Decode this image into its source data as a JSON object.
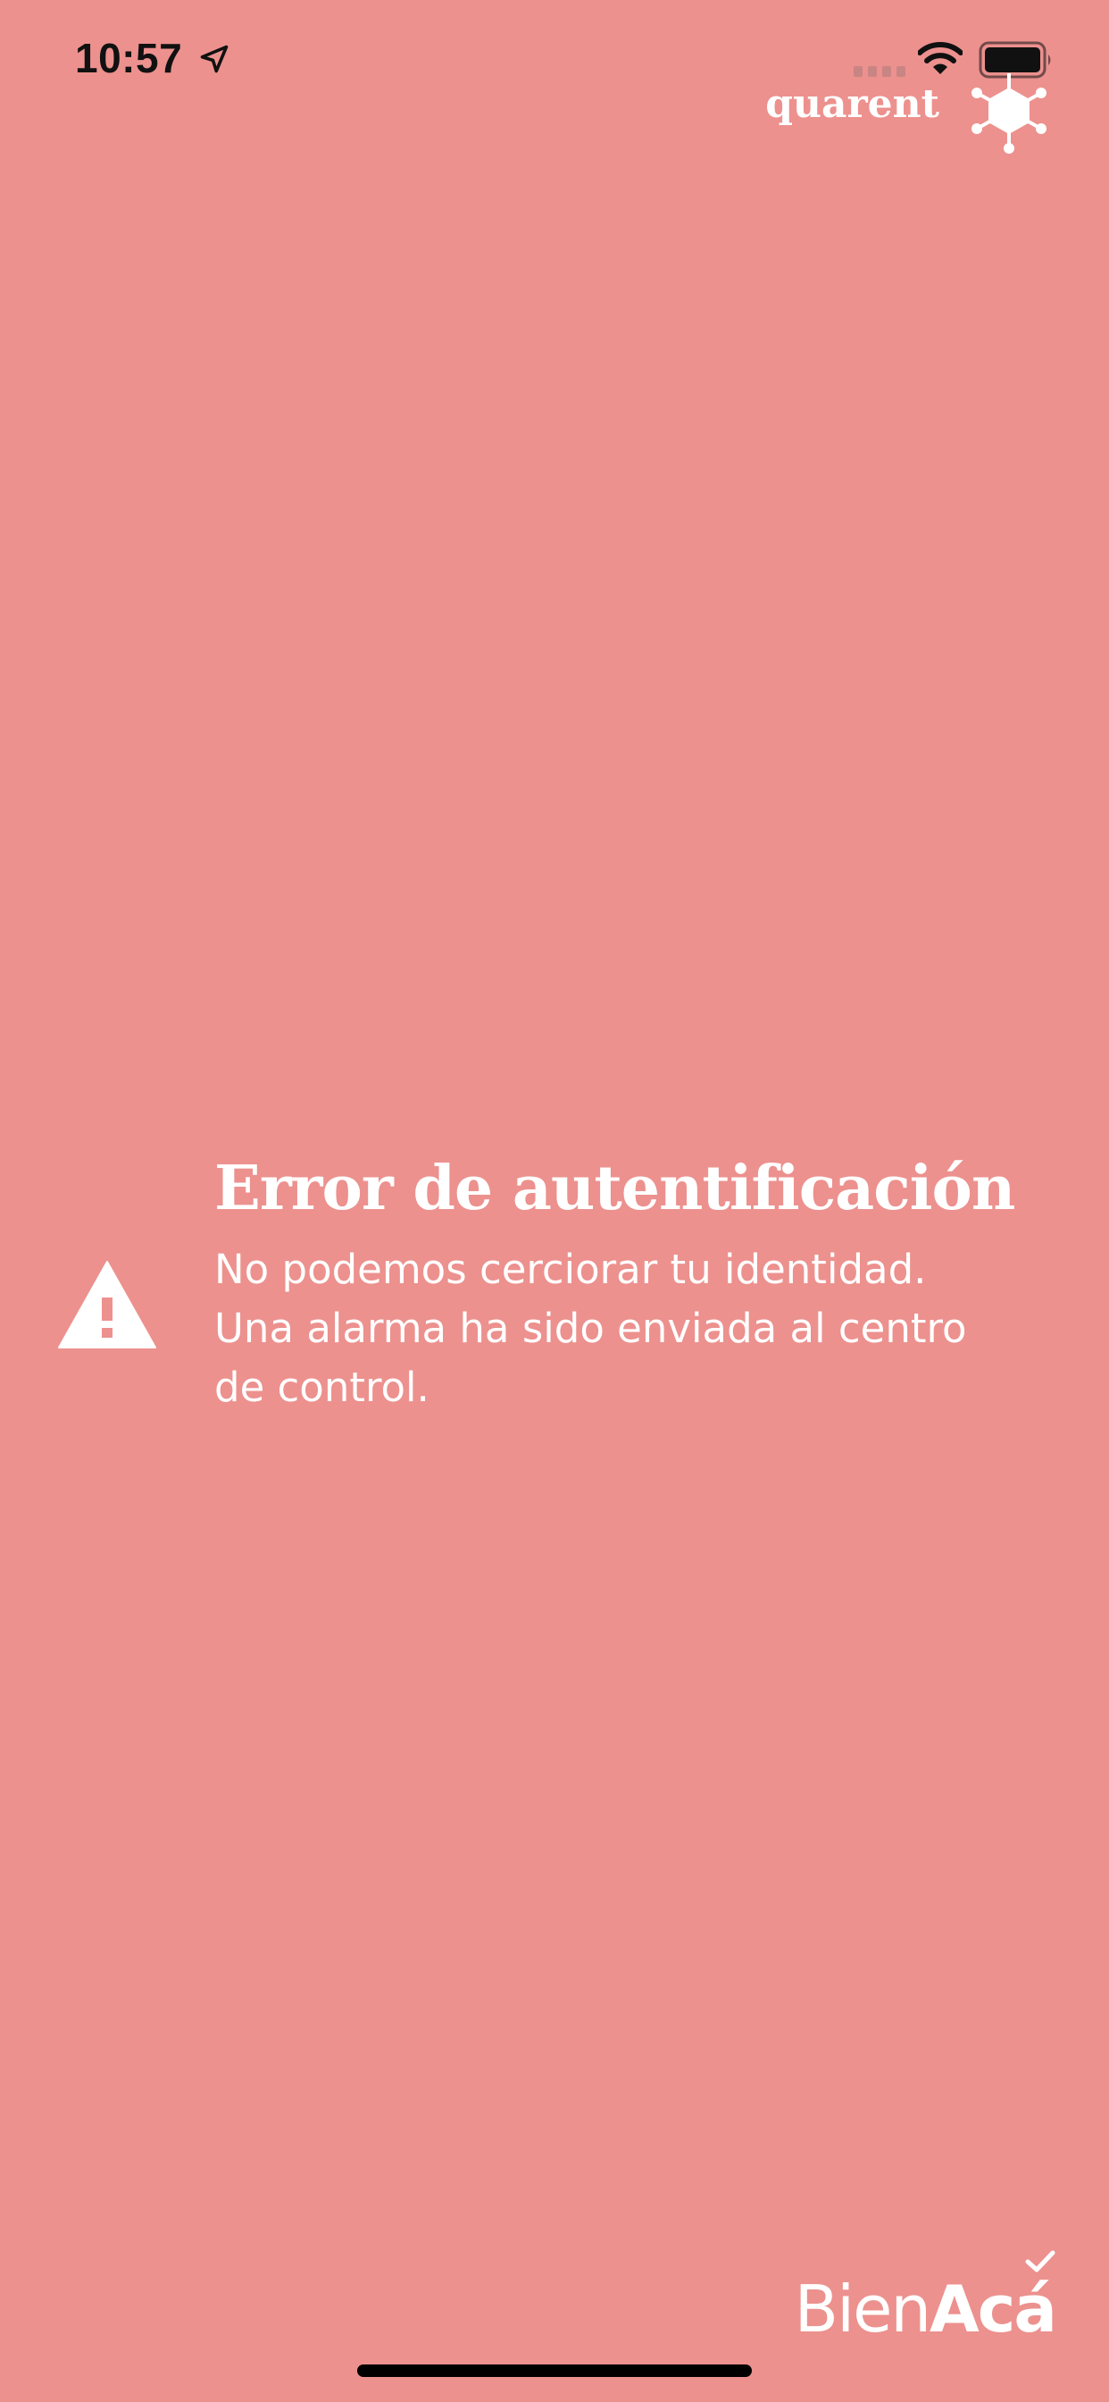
{
  "status_bar": {
    "time": "10:57",
    "icons": [
      "location-arrow-icon",
      "cellular-signal-icon",
      "wifi-icon",
      "battery-icon"
    ]
  },
  "brand": {
    "name": "quarent",
    "icon": "hexagon-network-icon"
  },
  "alert": {
    "icon": "warning-triangle-icon",
    "title": "Error de autentificación",
    "message": "No podemos cerciorar tu identidad. Una alarma ha sido enviada al centro de control."
  },
  "footer": {
    "logo_light": "Bien",
    "logo_bold": "Acá"
  },
  "colors": {
    "background": "#EC918E",
    "text": "#FFFFFF",
    "home_indicator": "#000000"
  }
}
